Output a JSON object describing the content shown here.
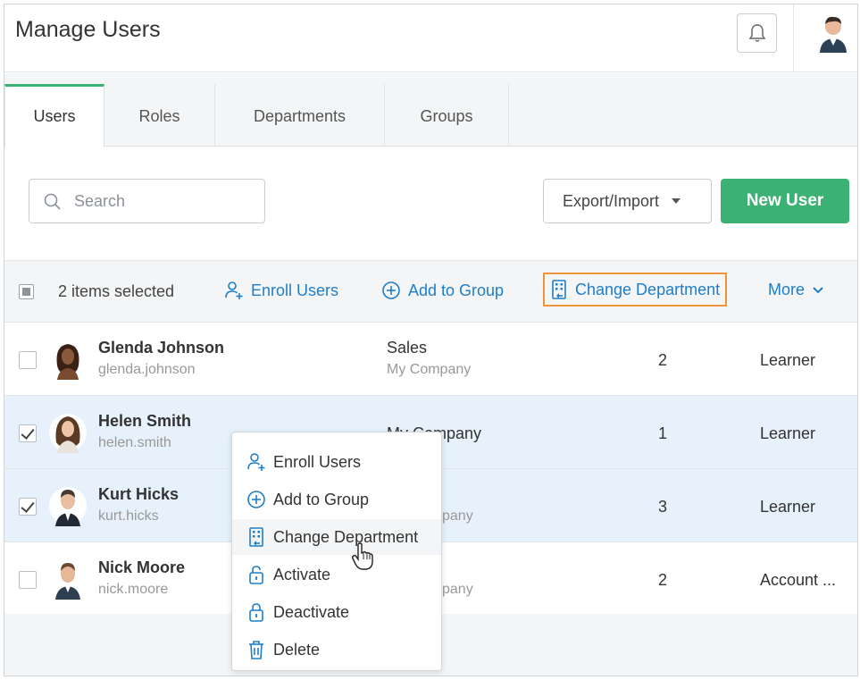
{
  "header": {
    "title": "Manage Users",
    "bell_icon": "bell-icon",
    "avatar_icon": "user-avatar-icon"
  },
  "tabs": [
    {
      "label": "Users",
      "active": true
    },
    {
      "label": "Roles",
      "active": false
    },
    {
      "label": "Departments",
      "active": false
    },
    {
      "label": "Groups",
      "active": false
    }
  ],
  "toolbar": {
    "search_placeholder": "Search",
    "export_label": "Export/Import",
    "new_user_label": "New User"
  },
  "bulk": {
    "selected_text": "2 items selected",
    "enroll_label": "Enroll Users",
    "add_group_label": "Add to Group",
    "change_dept_label": "Change Department",
    "more_label": "More"
  },
  "users": [
    {
      "name": "Glenda Johnson",
      "username": "glenda.johnson",
      "department": "Sales",
      "company": "My Company",
      "count": "2",
      "role": "Learner",
      "checked": false
    },
    {
      "name": "Helen Smith",
      "username": "helen.smith",
      "department": "",
      "company": "My Company",
      "count": "1",
      "role": "Learner",
      "checked": true
    },
    {
      "name": "Kurt Hicks",
      "username": "kurt.hicks",
      "department": "",
      "company": "pany",
      "count": "3",
      "role": "Learner",
      "checked": true
    },
    {
      "name": "Nick Moore",
      "username": "nick.moore",
      "department": "",
      "company": "pany",
      "count": "2",
      "role": "Account ...",
      "checked": false
    }
  ],
  "context_menu": [
    {
      "label": "Enroll Users",
      "icon": "enroll-user-icon"
    },
    {
      "label": "Add to Group",
      "icon": "add-circle-icon"
    },
    {
      "label": "Change Department",
      "icon": "building-icon"
    },
    {
      "label": "Activate",
      "icon": "unlock-icon"
    },
    {
      "label": "Deactivate",
      "icon": "lock-icon"
    },
    {
      "label": "Delete",
      "icon": "trash-icon"
    }
  ],
  "colors": {
    "accent_green": "#3bb273",
    "link_blue": "#1f7ec9",
    "highlight_orange": "#f0923a",
    "selected_row": "#e6f1fb"
  }
}
